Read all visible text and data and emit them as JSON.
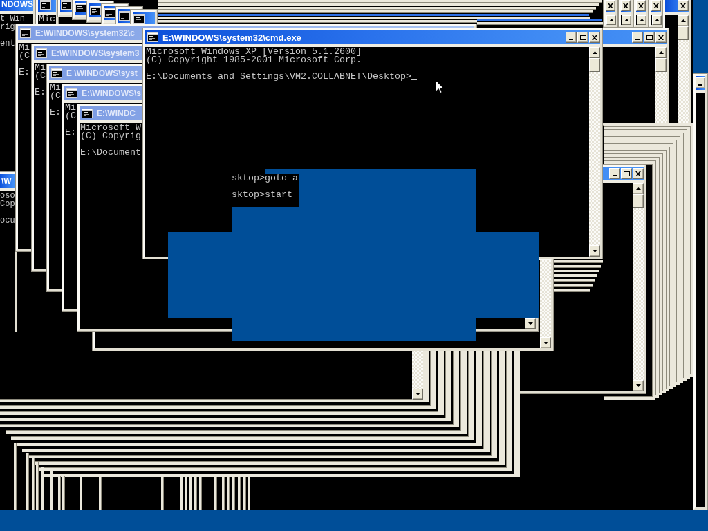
{
  "windows": [
    {
      "title": "NDOWS",
      "active": true,
      "banner": [
        "t Win",
        "rig"
      ],
      "prompt": "ent"
    },
    {
      "title": "\\W",
      "active": true,
      "banner": [
        "oso",
        "Cop"
      ],
      "prompt": "ocu"
    },
    {
      "active": true,
      "banner": [
        "Mic"
      ]
    },
    {
      "active": true
    },
    {
      "active": true
    },
    {
      "active": true
    },
    {
      "active": true
    },
    {
      "active": true
    },
    {
      "active": true
    },
    {
      "active": true
    },
    {
      "active": true
    },
    {
      "active": true
    },
    {
      "active": true
    },
    {
      "active": true
    },
    {
      "active": true
    },
    {
      "active": true
    },
    {
      "active": true
    },
    {
      "title": "E:\\WINDOWS\\system32\\c",
      "active": false,
      "banner": [
        "Mi",
        "(C"
      ],
      "prompt": "E:"
    },
    {
      "title": "E:\\WINDOWS\\system3",
      "active": false,
      "banner": [
        "Mi",
        "(C"
      ],
      "prompt": "E:"
    },
    {
      "title": "E \\WINDOWS\\syst",
      "active": false,
      "banner": [
        "Mi",
        "(C"
      ],
      "prompt": "E:"
    },
    {
      "title": "E:\\WINDOWS\\s",
      "active": false,
      "banner": [
        "Mi",
        "(C"
      ],
      "prompt": "E:"
    },
    {
      "title": "E:\\WINDC",
      "active": false,
      "banner": [
        "Microsoft W",
        "(C) Copyrig"
      ],
      "prompt": "E:\\Document"
    },
    {
      "title": "E:\\WINDOWS\\system32\\cmd.exe",
      "active": true,
      "banner": [
        "Microsoft Windows XP [Version 5.1.2600]",
        "(C) Copyright 1985-2001 Microsoft Corp."
      ],
      "prompt": "E:\\Documents and Settings\\VM2.COLLABNET\\Desktop>",
      "cursor": true
    }
  ],
  "fragment": {
    "lines": [
      "sktop>goto a",
      "sktop>start"
    ]
  }
}
